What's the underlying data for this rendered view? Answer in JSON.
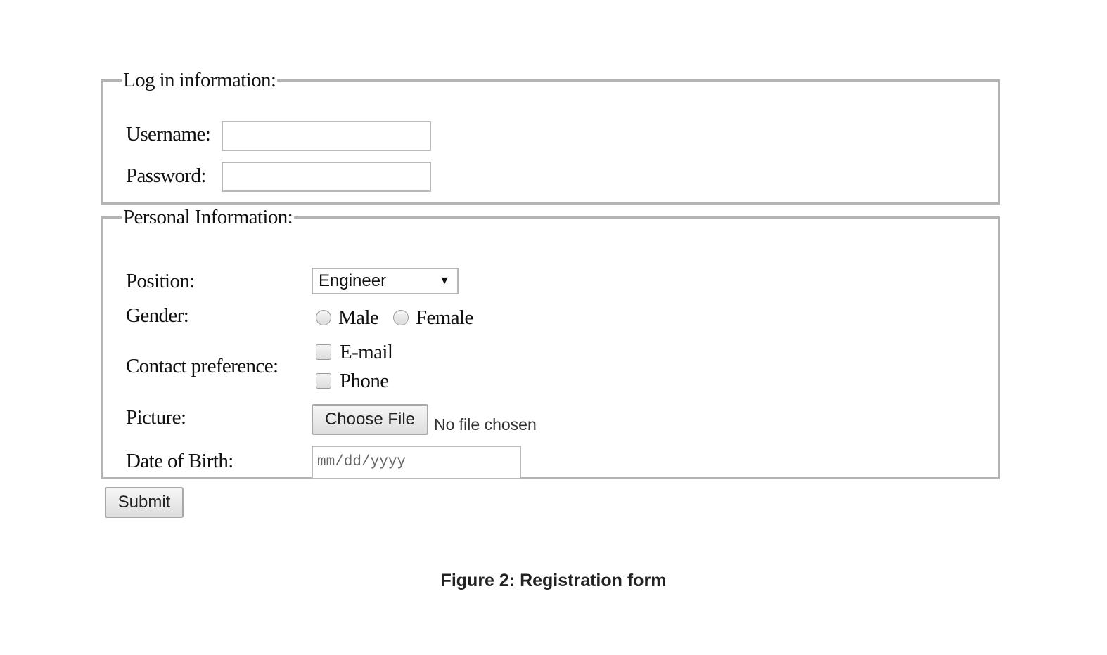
{
  "login": {
    "legend": "Log in information:",
    "username_label": "Username:",
    "username_value": "",
    "password_label": "Password:",
    "password_value": ""
  },
  "personal": {
    "legend": "Personal Information:",
    "position_label": "Position:",
    "position_selected": "Engineer",
    "gender_label": "Gender:",
    "gender_options": [
      "Male",
      "Female"
    ],
    "contact_label": "Contact preference:",
    "contact_options": [
      "E-mail",
      "Phone"
    ],
    "picture_label": "Picture:",
    "choose_file_label": "Choose File",
    "no_file_text": "No file chosen",
    "dob_label": "Date of Birth:",
    "dob_placeholder": "mm/dd/yyyy"
  },
  "submit_label": "Submit",
  "caption": "Figure 2: Registration form"
}
